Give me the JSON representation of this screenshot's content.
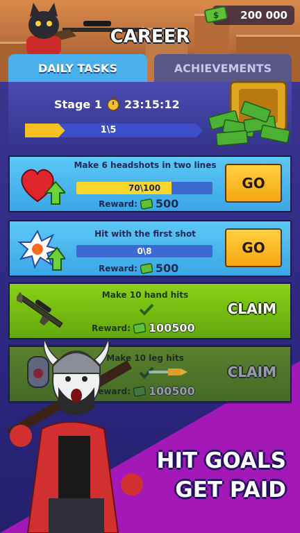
{
  "header": {
    "title": "CAREER",
    "currency_amount": "200 000"
  },
  "tabs": [
    {
      "label": "DAILY TASKS",
      "active": true
    },
    {
      "label": "ACHIEVEMENTS",
      "active": false
    }
  ],
  "stage": {
    "label": "Stage 1",
    "timer": "23:15:12",
    "progress_text": "1\\5",
    "progress_fraction": 0.2
  },
  "tasks": [
    {
      "title": "Make 6 headshots in two lines",
      "progress_text": "70\\100",
      "progress_fraction": 0.7,
      "reward_label": "Reward:",
      "reward_value": "500",
      "action": "GO",
      "icon": "heart-up-icon",
      "style": "blue"
    },
    {
      "title": "Hit with the first shot",
      "progress_text": "0\\8",
      "progress_fraction": 0.0,
      "reward_label": "Reward:",
      "reward_value": "500",
      "action": "GO",
      "icon": "explosion-up-icon",
      "style": "blue"
    },
    {
      "title": "Make 10 hand hits",
      "reward_label": "Reward:",
      "reward_value": "100500",
      "action": "CLAIM",
      "icon": "rifle-icon",
      "style": "green"
    },
    {
      "title": "Make 10 leg hits",
      "reward_label": "Reward:",
      "reward_value": "100500",
      "action": "CLAIM",
      "icon": "dogtag-icon",
      "style": "green"
    }
  ],
  "slogan": {
    "line1": "HIT GOALS",
    "line2": "GET PAID"
  },
  "colors": {
    "tab_active": "#4ab0ec",
    "card_blue": "#4cb8f0",
    "card_green": "#7cc014",
    "go_button": "#f9b824",
    "progress_fill": "#f9d72c",
    "slogan_bg": "#a418b8"
  }
}
